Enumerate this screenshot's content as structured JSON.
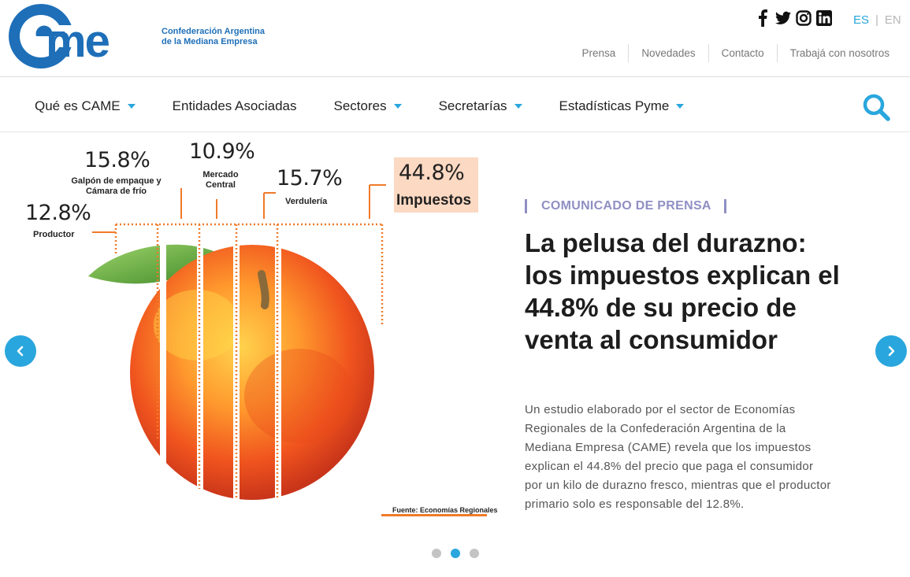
{
  "header": {
    "logo_text": "came",
    "org_name_line1": "Confederación Argentina",
    "org_name_line2": "de la Mediana Empresa",
    "social_icons": [
      "facebook-icon",
      "twitter-icon",
      "instagram-icon",
      "linkedin-icon"
    ],
    "lang_es": "ES",
    "lang_sep": "|",
    "lang_en": "EN",
    "top_links": [
      "Prensa",
      "Novedades",
      "Contacto",
      "Trabajá con nosotros"
    ]
  },
  "nav": {
    "items": [
      "Qué es CAME",
      "Entidades Asociadas",
      "Sectores",
      "Secretarías",
      "Estadísticas Pyme"
    ]
  },
  "slide": {
    "infographic": {
      "productor_pct": "12.8%",
      "productor_label": "Productor",
      "galpon_pct": "15.8%",
      "galpon_label_1": "Galpón de empaque y",
      "galpon_label_2": "Cámara de frío",
      "mercado_pct": "10.9%",
      "mercado_label_1": "Mercado",
      "mercado_label_2": "Central",
      "verduleria_pct": "15.7%",
      "verduleria_label": "Verdulería",
      "impuestos_pct": "44.8%",
      "impuestos_label": "Impuestos",
      "source": "Fuente: Economías Regionales"
    },
    "category": "COMUNICADO DE PRENSA",
    "headline": "La pelusa del durazno: los impuestos explican el 44.8% de su precio de venta al consumidor",
    "summary": "Un estudio elaborado por el sector de Economías Regionales de la Confederación Argentina de la Mediana Empresa (CAME) revela que los impuestos explican el 44.8% del precio que paga el consumidor por un kilo de durazno fresco, mientras que el productor primario solo es responsable del 12.8%."
  },
  "carousel": {
    "dot_count": 3,
    "active_index": 1
  },
  "colors": {
    "brand_blue": "#1e6fb8",
    "accent": "#29a6dd",
    "category": "#8f8fc4",
    "tax_box": "#fcd9c2"
  }
}
